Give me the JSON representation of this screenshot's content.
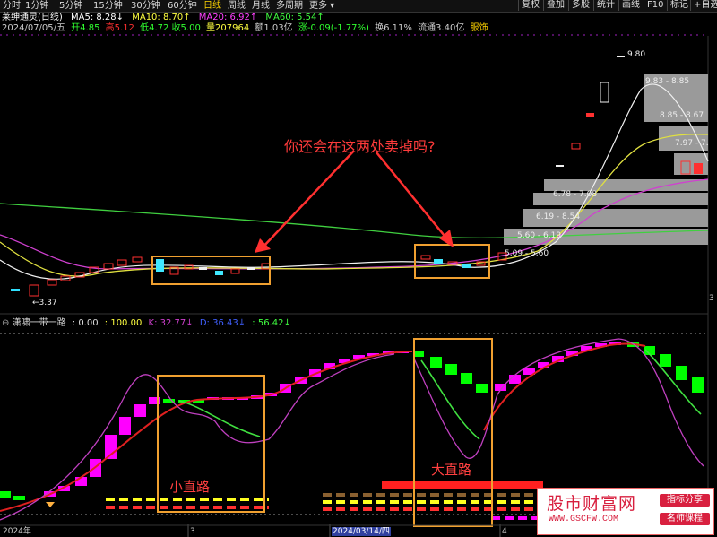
{
  "toolbar": {
    "periods": [
      "分时",
      "1分钟",
      "5分钟",
      "15分钟",
      "30分钟",
      "60分钟",
      "日线",
      "周线",
      "月线",
      "多周期",
      "更多"
    ],
    "active_period": "日线",
    "right_buttons": [
      "复权",
      "叠加",
      "多股",
      "统计",
      "画线",
      "F10",
      "标记",
      "+自选"
    ]
  },
  "stock": {
    "name": "莱绅通灵(日线)",
    "ma5": "MA5: 8.28↓",
    "ma10": "MA10: 8.70↑",
    "ma20": "MA20: 6.92↑",
    "ma60": "MA60: 5.54↑",
    "date_line": "2024/07/05/五",
    "open": "开4.85",
    "high": "高5.12",
    "low": "低4.72",
    "close": "收5.00",
    "volume": "量207964",
    "amount": "额1.03亿",
    "change": "涨-0.09(-1.77%)",
    "turnover": "换6.11%",
    "float_cap": "流通3.40亿",
    "sector": "服饰"
  },
  "price_labels": [
    "9.80",
    "9.83 - 8.85",
    "8.85 - 8.67",
    "7.97 - 7.",
    "6.78 - 7.08",
    "6.19 - 8.54",
    "5.60 - 6.19",
    "5.09 - 5.60",
    "3.37"
  ],
  "annotation_question": "你还会在这两处卖掉吗?",
  "indicator": {
    "name": "潇啸一带一路",
    "v1": ": 0.00",
    "v2": ": 100.00",
    "k": "K: 32.77↓",
    "d": "D: 36.43↓",
    "j": ": 56.42↓"
  },
  "label_small": "小直路",
  "label_big": "大直路",
  "axis": {
    "right_tick": "3",
    "dates": [
      "2024年",
      "3",
      "2024/03/14/四",
      "4"
    ]
  },
  "logo": {
    "title": "股市财富网",
    "url": "WWW.GSCFW.COM",
    "tag1": "指标分享",
    "tag2": "名师课程"
  },
  "colors": {
    "up": "#ff3030",
    "down": "#30ffd8",
    "ma5": "#ffffff",
    "ma10": "#ffff40",
    "ma20": "#ff40ff",
    "ma60": "#40ff40",
    "box": "#f0a030",
    "magenta_bar": "#ff00ff",
    "green_bar": "#00ff00"
  }
}
